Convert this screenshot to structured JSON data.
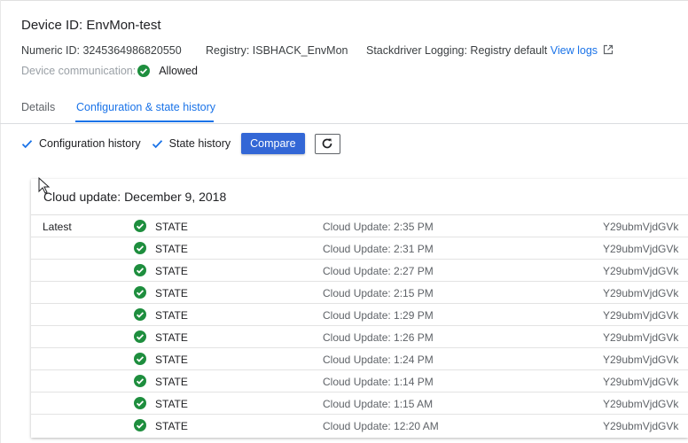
{
  "device": {
    "title": "Device ID: EnvMon-test",
    "numeric_id": "Numeric ID: 3245364986820550",
    "registry": "Registry: ISBHACK_EnvMon",
    "logging_label": "Stackdriver Logging: Registry default",
    "view_logs": "View logs",
    "communication_label": "Device communication:",
    "communication_value": "Allowed"
  },
  "tabs": [
    {
      "label": "Details",
      "active": false
    },
    {
      "label": "Configuration & state history",
      "active": true
    }
  ],
  "controls": {
    "config_history": "Configuration history",
    "config_history_checked": true,
    "state_history": "State history",
    "state_history_checked": true,
    "compare": "Compare"
  },
  "history": {
    "title": "Cloud update: December 9, 2018",
    "rows": [
      {
        "label": "Latest",
        "kind": "STATE",
        "time": "Cloud Update: 2:35 PM",
        "data": "Y29ubmVjdGVk"
      },
      {
        "label": "",
        "kind": "STATE",
        "time": "Cloud Update: 2:31 PM",
        "data": "Y29ubmVjdGVk"
      },
      {
        "label": "",
        "kind": "STATE",
        "time": "Cloud Update: 2:27 PM",
        "data": "Y29ubmVjdGVk"
      },
      {
        "label": "",
        "kind": "STATE",
        "time": "Cloud Update: 2:15 PM",
        "data": "Y29ubmVjdGVk"
      },
      {
        "label": "",
        "kind": "STATE",
        "time": "Cloud Update: 1:29 PM",
        "data": "Y29ubmVjdGVk"
      },
      {
        "label": "",
        "kind": "STATE",
        "time": "Cloud Update: 1:26 PM",
        "data": "Y29ubmVjdGVk"
      },
      {
        "label": "",
        "kind": "STATE",
        "time": "Cloud Update: 1:24 PM",
        "data": "Y29ubmVjdGVk"
      },
      {
        "label": "",
        "kind": "STATE",
        "time": "Cloud Update: 1:14 PM",
        "data": "Y29ubmVjdGVk"
      },
      {
        "label": "",
        "kind": "STATE",
        "time": "Cloud Update: 1:15 AM",
        "data": "Y29ubmVjdGVk"
      },
      {
        "label": "",
        "kind": "STATE",
        "time": "Cloud Update: 12:20 AM",
        "data": "Y29ubmVjdGVk"
      }
    ]
  },
  "icons": {
    "status": "check-circle-icon",
    "external": "open-in-new-icon",
    "refresh": "refresh-icon",
    "checkbox": "checkmark-icon"
  },
  "colors": {
    "accent": "#1a73e8",
    "button": "#3367d6",
    "success": "#1e8e3e"
  }
}
